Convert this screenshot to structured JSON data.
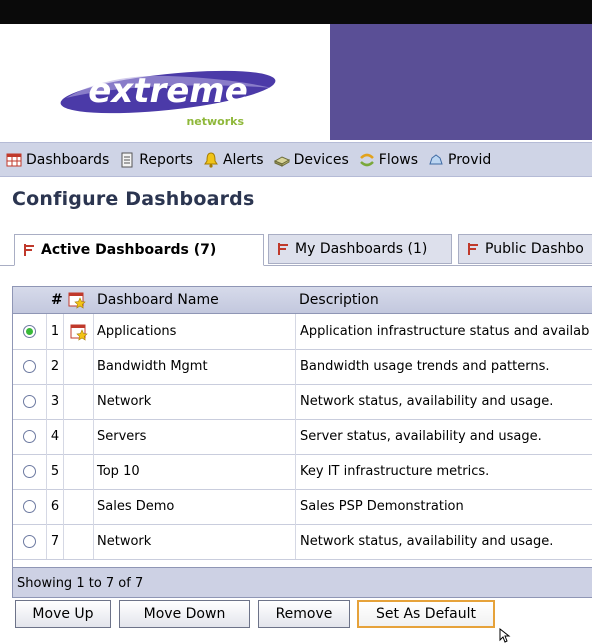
{
  "brand": {
    "logo_main": "extreme",
    "logo_sub": "networks",
    "colors": {
      "topbar": "#0a0a0a",
      "banner_purple": "#5a4f96",
      "logo_purple": "#4b3aa8",
      "logo_green": "#8fb83a"
    }
  },
  "nav": {
    "items": [
      {
        "label": "Dashboards",
        "icon": "dashboard-grid-icon"
      },
      {
        "label": "Reports",
        "icon": "report-icon"
      },
      {
        "label": "Alerts",
        "icon": "bell-icon"
      },
      {
        "label": "Devices",
        "icon": "device-icon"
      },
      {
        "label": "Flows",
        "icon": "flows-icon"
      },
      {
        "label": "Provid",
        "icon": "provider-icon"
      }
    ]
  },
  "page": {
    "title": "Configure Dashboards"
  },
  "tabs": [
    {
      "label": "Active Dashboards (7)",
      "active": true
    },
    {
      "label": "My Dashboards (1)",
      "active": false
    },
    {
      "label": "Public Dashbo",
      "active": false
    }
  ],
  "table": {
    "headers": {
      "num": "#",
      "name": "Dashboard Name",
      "description": "Description"
    },
    "rows": [
      {
        "num": "1",
        "name": "Applications",
        "description": "Application infrastructure status and availab",
        "selected": true,
        "default": true
      },
      {
        "num": "2",
        "name": "Bandwidth Mgmt",
        "description": "Bandwidth usage trends and patterns.",
        "selected": false,
        "default": false
      },
      {
        "num": "3",
        "name": "Network",
        "description": "Network status, availability and usage.",
        "selected": false,
        "default": false
      },
      {
        "num": "4",
        "name": "Servers",
        "description": "Server status, availability and usage.",
        "selected": false,
        "default": false
      },
      {
        "num": "5",
        "name": "Top 10",
        "description": "Key IT infrastructure metrics.",
        "selected": false,
        "default": false
      },
      {
        "num": "6",
        "name": "Sales Demo",
        "description": "Sales PSP Demonstration",
        "selected": false,
        "default": false
      },
      {
        "num": "7",
        "name": "Network",
        "description": "Network status, availability and usage.",
        "selected": false,
        "default": false
      }
    ],
    "footer": "Showing 1 to 7 of 7"
  },
  "buttons": {
    "move_up": "Move Up",
    "move_down": "Move Down",
    "remove": "Remove",
    "set_default": "Set As Default"
  }
}
